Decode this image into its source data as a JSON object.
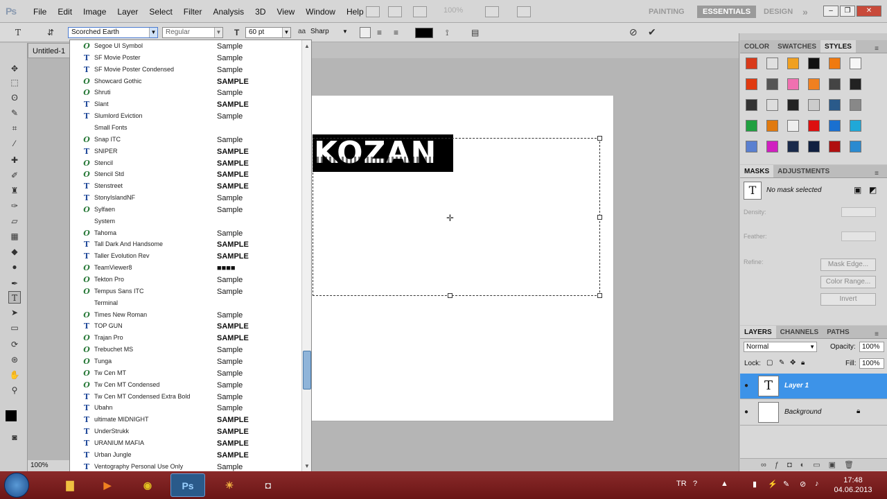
{
  "app": {
    "logo": "Ps",
    "menus": [
      "File",
      "Edit",
      "Image",
      "Layer",
      "Select",
      "Filter",
      "Analysis",
      "3D",
      "View",
      "Window",
      "Help"
    ],
    "zoom_display": "100%",
    "workspaces": [
      "PAINTING",
      "ESSENTIALS",
      "DESIGN"
    ],
    "active_workspace": "ESSENTIALS",
    "overflow": "»"
  },
  "options": {
    "font_family": "Scorched Earth",
    "font_style": "Regular",
    "font_size": "60 pt",
    "antialias": "Sharp"
  },
  "document": {
    "tab_title": "Untitled-1",
    "canvas_text": "KOZAN",
    "zoom": "100%"
  },
  "fontlist": [
    {
      "name": "Segoe UI Symbol",
      "type": "ot",
      "sample": "Sample"
    },
    {
      "name": "SF Movie Poster",
      "type": "tt",
      "sample": "Sample"
    },
    {
      "name": "SF Movie Poster Condensed",
      "type": "tt",
      "sample": "Sample"
    },
    {
      "name": "Showcard Gothic",
      "type": "ot",
      "sample": "SAMPLE"
    },
    {
      "name": "Shruti",
      "type": "ot",
      "sample": "Sample"
    },
    {
      "name": "Slant",
      "type": "tt",
      "sample": "SAMPLE"
    },
    {
      "name": "Slumlord Eviction",
      "type": "tt",
      "sample": "Sample"
    },
    {
      "name": "Small Fonts",
      "type": "",
      "sample": ""
    },
    {
      "name": "Snap ITC",
      "type": "ot",
      "sample": "Sample"
    },
    {
      "name": "SNIPER",
      "type": "tt",
      "sample": "SAMPLE"
    },
    {
      "name": "Stencil",
      "type": "ot",
      "sample": "SAMPLE"
    },
    {
      "name": "Stencil Std",
      "type": "ot",
      "sample": "SAMPLE"
    },
    {
      "name": "Stenstreet",
      "type": "tt",
      "sample": "SAMPLE"
    },
    {
      "name": "StonyIslandNF",
      "type": "tt",
      "sample": "Sample"
    },
    {
      "name": "Sylfaen",
      "type": "ot",
      "sample": "Sample"
    },
    {
      "name": "System",
      "type": "",
      "sample": ""
    },
    {
      "name": "Tahoma",
      "type": "ot",
      "sample": "Sample"
    },
    {
      "name": "Tall Dark And Handsome",
      "type": "tt",
      "sample": "SAMPLE"
    },
    {
      "name": "Taller  Evolution Rev",
      "type": "tt",
      "sample": "SAMPLE"
    },
    {
      "name": "TeamViewer8",
      "type": "ot",
      "sample": "■■■■"
    },
    {
      "name": "Tekton Pro",
      "type": "ot",
      "sample": "Sample"
    },
    {
      "name": "Tempus Sans ITC",
      "type": "ot",
      "sample": "Sample"
    },
    {
      "name": "Terminal",
      "type": "",
      "sample": ""
    },
    {
      "name": "Times New Roman",
      "type": "ot",
      "sample": "Sample"
    },
    {
      "name": "TOP GUN",
      "type": "tt",
      "sample": "SAMPLE"
    },
    {
      "name": "Trajan Pro",
      "type": "ot",
      "sample": "SAMPLE"
    },
    {
      "name": "Trebuchet MS",
      "type": "ot",
      "sample": "Sample"
    },
    {
      "name": "Tunga",
      "type": "ot",
      "sample": "Sample"
    },
    {
      "name": "Tw Cen MT",
      "type": "ot",
      "sample": "Sample"
    },
    {
      "name": "Tw Cen MT Condensed",
      "type": "ot",
      "sample": "Sample"
    },
    {
      "name": "Tw Cen MT Condensed Extra Bold",
      "type": "tt",
      "sample": "Sample"
    },
    {
      "name": "Ubahn",
      "type": "tt",
      "sample": "Sample"
    },
    {
      "name": "ultimate MIDNIGHT",
      "type": "tt",
      "sample": "SAMPLE"
    },
    {
      "name": "UnderStrukk",
      "type": "tt",
      "sample": "SAMPLE"
    },
    {
      "name": "URANIUM MAFIA",
      "type": "tt",
      "sample": "SAMPLE"
    },
    {
      "name": "Urban Jungle",
      "type": "tt",
      "sample": "SAMPLE"
    },
    {
      "name": "Ventography Personal Use Only",
      "type": "tt",
      "sample": "Sample"
    }
  ],
  "panels": {
    "styles_tabs": [
      "COLOR",
      "SWATCHES",
      "STYLES"
    ],
    "styles_active": "STYLES",
    "swatch_colors": [
      "#d83a1a",
      "#e0e0e0",
      "#f0a020",
      "#111111",
      "#f07a10",
      "#f6f6f6",
      "#e03a10",
      "#555555",
      "#f070b0",
      "#f08020",
      "#444444",
      "#222222",
      "#333333",
      "#dddddd",
      "#222222",
      "#cccccc",
      "#2a5a8a",
      "#888888",
      "#20a040",
      "#e07a10",
      "#eeeeee",
      "#dd1010",
      "#1a70d0",
      "#20a8d8",
      "#5a80d0",
      "#d020c0",
      "#1a2a4a",
      "#102040",
      "#b01010",
      "#2a8ad0"
    ],
    "masks_tabs": [
      "MASKS",
      "ADJUSTMENTS"
    ],
    "masks_active": "MASKS",
    "masks_status": "No mask selected",
    "masks_labels": {
      "density": "Density:",
      "feather": "Feather:",
      "refine": "Refine:"
    },
    "masks_buttons": [
      "Mask Edge...",
      "Color Range...",
      "Invert"
    ],
    "layers_tabs": [
      "LAYERS",
      "CHANNELS",
      "PATHS"
    ],
    "layers_active": "LAYERS",
    "blend_mode": "Normal",
    "opacity_label": "Opacity:",
    "opacity": "100%",
    "lock_label": "Lock:",
    "fill_label": "Fill:",
    "fill": "100%",
    "layers": [
      {
        "name": "Layer 1",
        "thumb": "T",
        "selected": true
      },
      {
        "name": "Background",
        "thumb": "",
        "selected": false
      }
    ]
  },
  "taskbar": {
    "lang": "TR",
    "time": "17:48",
    "date": "04.06.2013",
    "apps": [
      "Explorer",
      "Media",
      "Chrome",
      "Ps",
      "Weather",
      "Camera"
    ]
  }
}
